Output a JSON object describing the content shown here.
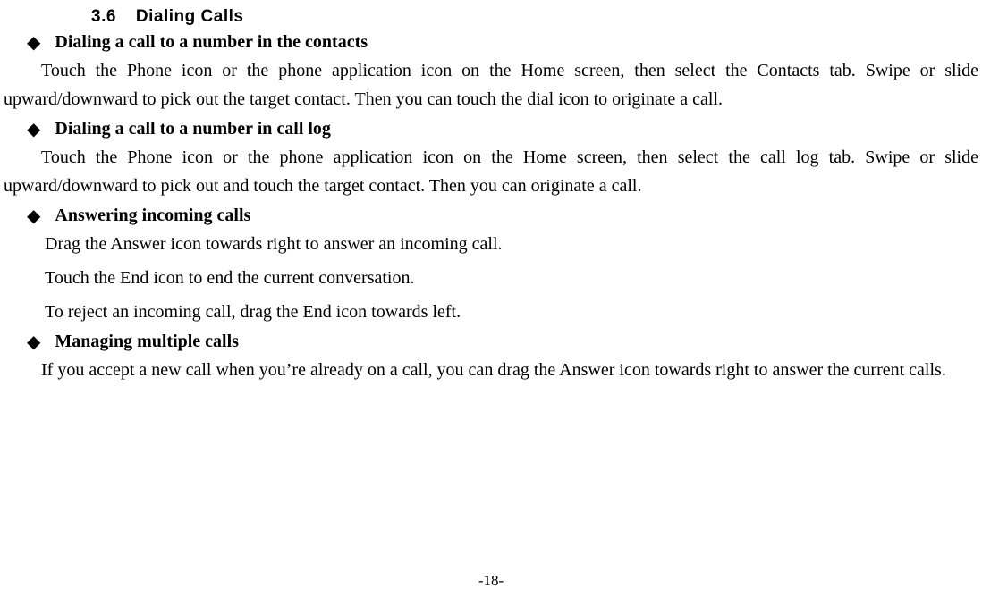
{
  "section": {
    "number": "3.6",
    "title": "Dialing Calls"
  },
  "bullets": {
    "b1": {
      "title": "Dialing a call to a number in the contacts",
      "para": "Touch the Phone icon or the phone application icon on the Home screen, then select the Contacts tab. Swipe or slide upward/downward to pick out the target contact. Then you can touch the dial icon to originate a call."
    },
    "b2": {
      "title": "Dialing a call to a number in call log",
      "para": "Touch the Phone icon or the phone application icon on the Home screen, then select the call log tab. Swipe or slide upward/downward to pick out and touch the target contact. Then you can originate a call."
    },
    "b3": {
      "title": "Answering incoming calls",
      "l1": "Drag the Answer icon towards right to answer an incoming call.",
      "l2": "Touch the End icon to end the current conversation.",
      "l3": "To reject an incoming call, drag the End icon towards left."
    },
    "b4": {
      "title": "Managing multiple calls",
      "para": "If you accept a new call when you’re already on a call, you can drag the Answer icon towards right to answer the current calls."
    }
  },
  "footer": "-18-"
}
